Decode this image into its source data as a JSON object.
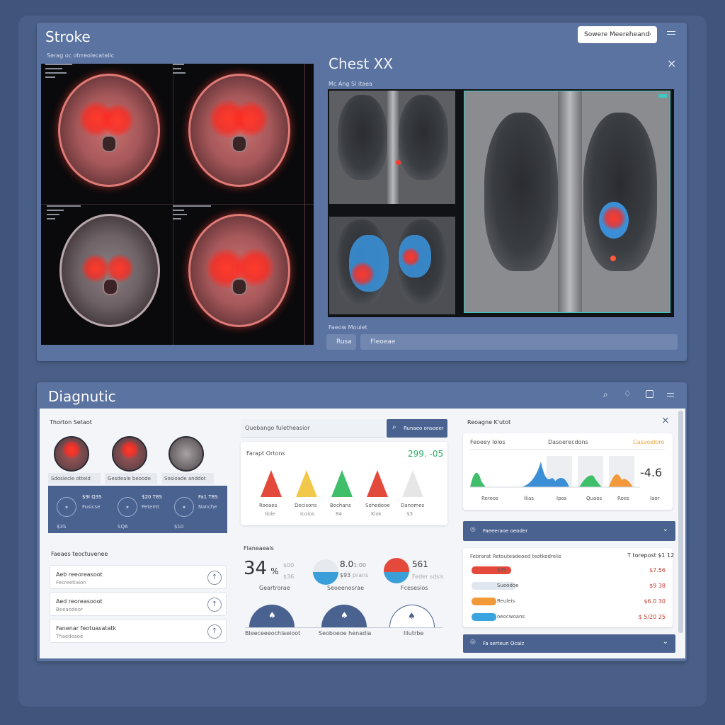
{
  "colors": {
    "accent_red": "#ff3a2a",
    "accent_blue": "#3a8fd6",
    "panel": "#5b73a0",
    "navy": "#4a6290",
    "green": "#2fae6a"
  },
  "top_left": {
    "title": "Stroke",
    "subtitle": "Serag oc otrreolecatalic",
    "search_placeholder": "Sowere Meereheand"
  },
  "top_right": {
    "title": "Chest XX",
    "subtitle": "Mc Ang Sl itaea",
    "footer_label": "Faeow Moulet",
    "btn_a": "Rusa",
    "btn_b": "Fleoeae"
  },
  "bottom": {
    "title": "Diagnutic",
    "col1": {
      "heading": "Thorton Setaot",
      "thumbs": [
        "Sdosiecle otteid",
        "Gesdeale beoode",
        "Sosioade anddot"
      ],
      "stats": [
        {
          "top": "$9I Q3S",
          "mid": "Fusicse",
          "bot": "$3S"
        },
        {
          "top": "$20 T8S",
          "mid": "Petemt",
          "bot": "SQ6"
        },
        {
          "top": "Fa1 T8S",
          "mid": "Nanche",
          "bot": "$10"
        }
      ],
      "list_heading": "Faeaes teoctuvenee",
      "list": [
        {
          "a": "Aeb reeoreasoot",
          "b": "Fecreetiaion"
        },
        {
          "a": "Aed reoreasooot",
          "b": "Beeaodeor"
        },
        {
          "a": "Fanenar feotuasatatk",
          "b": "Thaedosoe"
        }
      ],
      "list_button_icon": "circle-arrow-icon"
    },
    "col2": {
      "search_placeholder": "Quebango fuletheasior",
      "search_button": "Runaeo onsoeer",
      "chart_title": "Farapt Ortons",
      "chart_value": "299. -05",
      "triangles": [
        {
          "label": "Roeaes",
          "sub": "Ilole",
          "color": "#e34a3c"
        },
        {
          "label": "Decisons",
          "sub": "Icoios",
          "color": "#f2c84b"
        },
        {
          "label": "Bochans",
          "sub": "84",
          "color": "#3fbf6a"
        },
        {
          "label": "Sohedeoe",
          "sub": "Kiok",
          "color": "#e34a3c"
        },
        {
          "label": "Danomes",
          "sub": "$3",
          "color": "#e6e6e6"
        }
      ],
      "perf_heading": "Flaneaeals",
      "big_value": "34",
      "big_unit": "%",
      "big_small": "$00",
      "big_small2": "$36",
      "big_caption": "Geartrorae",
      "mid_value": "8.0",
      "mid_value2": "1:00",
      "mid_small": "$93",
      "mid_small2": "prans",
      "mid_caption": "Seoeenosrae",
      "right_value": "561",
      "right_small": "Feder sdsis",
      "right_caption": "Fcesesios",
      "domes": [
        "Bleeceeeochlaeioot",
        "Seoboeoe henadia",
        "Illutrbe"
      ]
    },
    "col3": {
      "heading": "Reoagne K'utot",
      "chart_label_a": "Feoeey Iolos",
      "chart_label_b": "Dasoerecdons",
      "chart_label_c": "Casvoeloro",
      "chart_big": "-4.6",
      "chart_axis": [
        "Reroos",
        "Ilias",
        "Ipos",
        "Quaos",
        "Roes",
        "Iaor"
      ],
      "dropdown1": "Faeeeraoe oeoder",
      "table_title": "Febrarat Retouteadeoed teotkodrelis",
      "table_total": "T torepost $1 12",
      "rows": [
        {
          "name": "$3S",
          "value": "$7.56",
          "color": "#e34a3c",
          "fill": 0.8
        },
        {
          "name": "Sueodoe",
          "value": "$9 38",
          "color": "#dfe6ef",
          "fill": 0.9
        },
        {
          "name": "Reuleis",
          "value": "$6.0 30",
          "color": "#f29a3a",
          "fill": 0.5
        },
        {
          "name": "oeocwoans",
          "value": "$ 5/20 25",
          "color": "#3aa4e0",
          "fill": 0.5
        }
      ],
      "dropdown2": "Fa serteun Ocaiz"
    }
  }
}
